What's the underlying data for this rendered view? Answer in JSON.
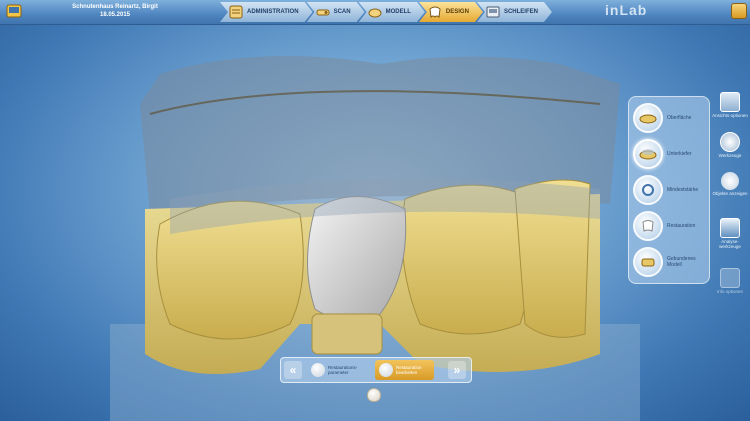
{
  "header": {
    "patient_name": "Schnutenhaus Reinartz, Birgit",
    "date": "18.05.2015",
    "brand": "inLab"
  },
  "steps": [
    {
      "label": "ADMINISTRATION",
      "icon": "clipboard-icon",
      "active": false
    },
    {
      "label": "SCAN",
      "icon": "scanner-icon",
      "active": false
    },
    {
      "label": "MODELL",
      "icon": "model-icon",
      "active": false
    },
    {
      "label": "DESIGN",
      "icon": "tooth-design-icon",
      "active": true
    },
    {
      "label": "SCHLEIFEN",
      "icon": "milling-machine-icon",
      "active": false
    }
  ],
  "tools": [
    {
      "label": "Oberfläche",
      "icon": "surface-icon"
    },
    {
      "label": "Unterkiefer",
      "icon": "lower-jaw-icon"
    },
    {
      "label": "Mindeststärke",
      "icon": "min-thickness-icon"
    },
    {
      "label": "Restauration",
      "icon": "restoration-icon"
    },
    {
      "label": "Gebundenes Modell",
      "icon": "linked-model-icon"
    }
  ],
  "side_buttons": [
    {
      "label": "Ansichts-optionen",
      "icon": "view-options-icon",
      "enabled": true
    },
    {
      "label": "Werkzeuge",
      "icon": "tools-icon",
      "enabled": true
    },
    {
      "label": "Objekte anzeigen",
      "icon": "show-objects-icon",
      "enabled": true
    },
    {
      "label": "Analyse-werkzeuge",
      "icon": "analysis-tools-icon",
      "enabled": true
    },
    {
      "label": "Info optionen",
      "icon": "info-icon",
      "enabled": false
    }
  ],
  "restoration_bar": {
    "tabs": [
      {
        "label": "Restaurations-parameter",
        "active": false
      },
      {
        "label": "Restauration bearbeiten",
        "active": true
      }
    ],
    "prev_label": "«",
    "next_label": "»"
  },
  "colors": {
    "accent_gold": "#e5a934",
    "tooth_yellow": "#e6d17a",
    "crown_gray": "#dcdcdc",
    "background_blue": "#6fa3d2"
  }
}
